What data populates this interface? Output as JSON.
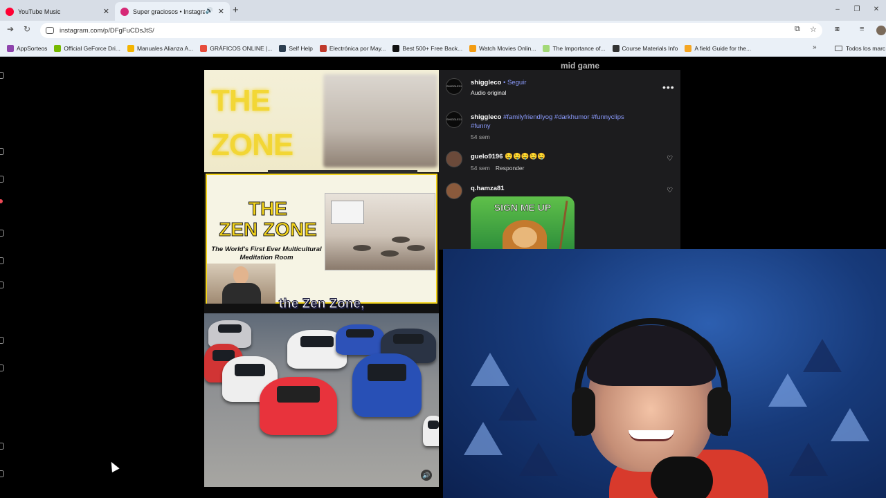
{
  "browser": {
    "tabs": [
      {
        "title": "YouTube Music",
        "favicon_color": "#ff0033",
        "active": false
      },
      {
        "title": "Super graciosos • Instagram",
        "favicon_color": "#d62976",
        "active": true
      }
    ],
    "new_tab_symbol": "+",
    "url": "instagram.com/p/DFgFuCDsJtS/",
    "window_controls": [
      "–",
      "❐",
      "✕"
    ],
    "bookmarks": [
      {
        "label": "AppSorteos",
        "color": "#8e44ad"
      },
      {
        "label": "Official GeForce Dri...",
        "color": "#76b900"
      },
      {
        "label": "Manuales Alianza A...",
        "color": "#f4b400"
      },
      {
        "label": "GRÁFICOS ONLINE |...",
        "color": "#e74c3c"
      },
      {
        "label": "Self Help",
        "color": "#2c3e50"
      },
      {
        "label": "Electrónica por May...",
        "color": "#c0392b"
      },
      {
        "label": "Best 500+ Free Back...",
        "color": "#111111"
      },
      {
        "label": "Watch Movies Onlin...",
        "color": "#f39c12"
      },
      {
        "label": "The Importance of...",
        "color": "#a3d977"
      },
      {
        "label": "Course Materials Info",
        "color": "#333333"
      },
      {
        "label": "A field Guide for the...",
        "color": "#f5a623"
      }
    ],
    "bookmarks_folder": "Todos los marc"
  },
  "post": {
    "background_text": "mid game",
    "slide_title_top": "THE\nZONE",
    "slide_title": "THE\nZEN ZONE",
    "slide_subtitle": "The World's First Ever Multicultural Meditation Room",
    "caption": "the Zen Zone,"
  },
  "comments_panel": {
    "author": "shiggleco",
    "follow_sep": "•",
    "follow_label": "Seguir",
    "audio": "Audio original",
    "more_icon": "more-horizontal-icon",
    "caption": {
      "user": "shiggleco",
      "tags": "#familyfriendlyog #darkhumor #funnyclips",
      "tags2": "#funny",
      "time": "54 sem"
    },
    "comments": [
      {
        "user": "guelo9196",
        "text": "🤤🤤🤤🤤🤤",
        "time": "54 sem",
        "reply": "Responder"
      },
      {
        "user": "q.hamza81",
        "sticker_text": "SIGN ME UP"
      }
    ]
  },
  "colors": {
    "instagram_link": "#8c9cff",
    "panel_bg": "#1c1c1e",
    "zen_yellow": "#f3d31b"
  }
}
